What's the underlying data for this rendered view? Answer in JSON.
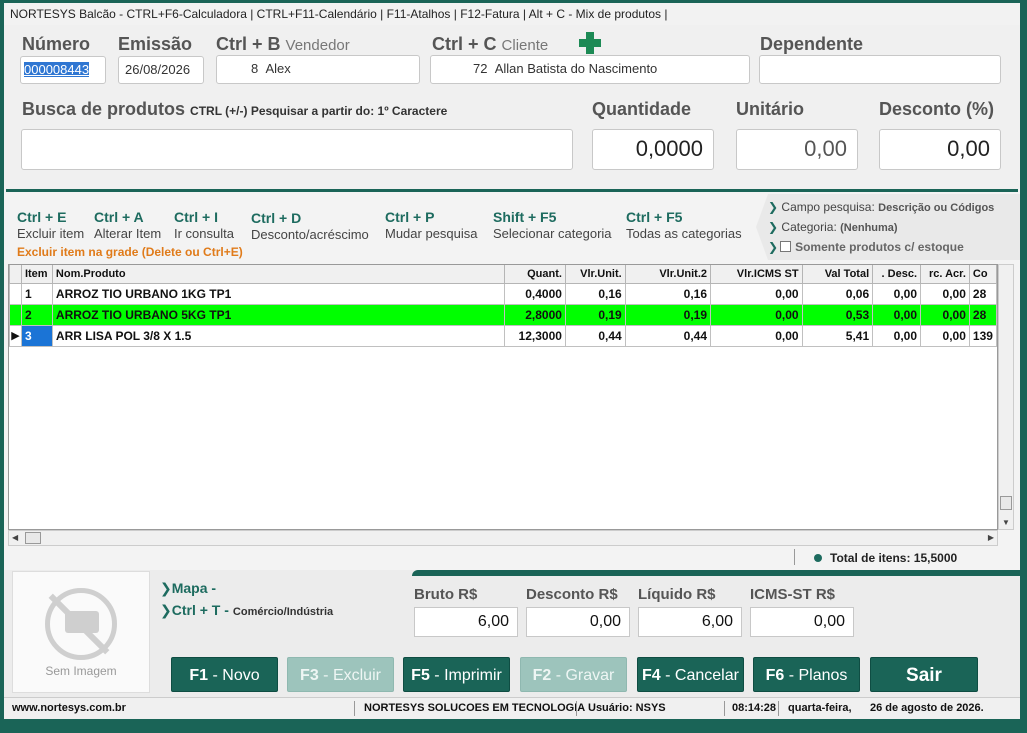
{
  "window": {
    "title": "NORTESYS Balcão  -  CTRL+F6-Calculadora  |  CTRL+F11-Calendário  |  F11-Atalhos  |  F12-Fatura  | Alt + C - Mix de produtos |"
  },
  "header": {
    "numero_label": "Número",
    "numero_value": "000008443",
    "emissao_label": "Emissão",
    "emissao_value": "26/08/2026",
    "vendedor_shortcut": "Ctrl + B",
    "vendedor_label": "Vendedor",
    "vendedor_code": "8",
    "vendedor_name": "Alex",
    "cliente_shortcut": "Ctrl + C",
    "cliente_label": "Cliente",
    "cliente_code": "72",
    "cliente_name": "Allan Batista do Nascimento",
    "dependente_label": "Dependente",
    "dependente_value": ""
  },
  "search": {
    "label": "Busca de produtos",
    "hint": "CTRL (+/-)  Pesquisar a partir do: 1º Caractere",
    "value": "",
    "quantidade_label": "Quantidade",
    "quantidade_value": "0,0000",
    "unitario_label": "Unitário",
    "unitario_value": "0,00",
    "desconto_label": "Desconto (%)",
    "desconto_value": "0,00"
  },
  "shortcuts": [
    {
      "key": "Ctrl + E",
      "desc": "Excluir item"
    },
    {
      "key": "Ctrl + A",
      "desc": "Alterar Item"
    },
    {
      "key": "Ctrl + I",
      "desc": "Ir consulta"
    },
    {
      "key": "Ctrl + D",
      "desc": "Desconto/acréscimo"
    },
    {
      "key": "Ctrl + P",
      "desc": "Mudar pesquisa"
    },
    {
      "key": "Shift + F5",
      "desc": "Selecionar categoria"
    },
    {
      "key": "Ctrl + F5",
      "desc": "Todas as categorias"
    }
  ],
  "delete_hint": "Excluir item na grade (Delete ou Ctrl+E)",
  "filters": {
    "campo_label": "Campo pesquisa:",
    "campo_value": "Descrição ou Códigos",
    "categoria_label": "Categoria:",
    "categoria_value": "(Nenhuma)",
    "estoque_label": "Somente produtos c/ estoque",
    "estoque_checked": false
  },
  "grid": {
    "columns": [
      "Item",
      "Nom.Produto",
      "Quant.",
      "Vlr.Unit.",
      "Vlr.Unit.2",
      "Vlr.ICMS ST",
      "Val Total",
      ". Desc.",
      "rc. Acr.",
      "Co"
    ],
    "rows": [
      [
        "1",
        "ARROZ TIO URBANO 1KG TP1",
        "0,4000",
        "0,16",
        "0,16",
        "0,00",
        "0,06",
        "0,00",
        "0,00",
        "28"
      ],
      [
        "2",
        "ARROZ TIO URBANO 5KG TP1",
        "2,8000",
        "0,19",
        "0,19",
        "0,00",
        "0,53",
        "0,00",
        "0,00",
        "28"
      ],
      [
        "3",
        "ARR LISA POL 3/8 X 1.5",
        "12,3000",
        "0,44",
        "0,44",
        "0,00",
        "5,41",
        "0,00",
        "0,00",
        "139"
      ]
    ]
  },
  "total_itens": "Total de itens: 15,5000",
  "image_placeholder": "Sem Imagem",
  "links": {
    "mapa": "Mapa -",
    "ctrl_t": "Ctrl + T -",
    "ctrl_t_desc": "Comércio/Indústria"
  },
  "totals": {
    "bruto_label": "Bruto R$",
    "bruto_value": "6,00",
    "desconto_label": "Desconto R$",
    "desconto_value": "0,00",
    "liquido_label": "Líquido R$",
    "liquido_value": "6,00",
    "icms_label": "ICMS-ST R$",
    "icms_value": "0,00"
  },
  "buttons": {
    "novo_key": "F1",
    "novo": "Novo",
    "excluir_key": "F3",
    "excluir": "Excluir",
    "imprimir_key": "F5",
    "imprimir": "Imprimir",
    "gravar_key": "F2",
    "gravar": "Gravar",
    "cancelar_key": "F4",
    "cancelar": "Cancelar",
    "planos_key": "F6",
    "planos": "Planos",
    "sair": "Sair"
  },
  "status": {
    "site": "www.nortesys.com.br",
    "company": "NORTESYS SOLUCOES EM TECNOLOGIA",
    "user": "Usuário: NSYS",
    "time": "08:14:28",
    "weekday": "quarta-feira,",
    "date": "26 de agosto de 2026."
  },
  "colors": {
    "accent": "#1a6457",
    "row_highlight": "#00ff00",
    "selection": "#1b74d6",
    "warning": "#e07b1a"
  }
}
